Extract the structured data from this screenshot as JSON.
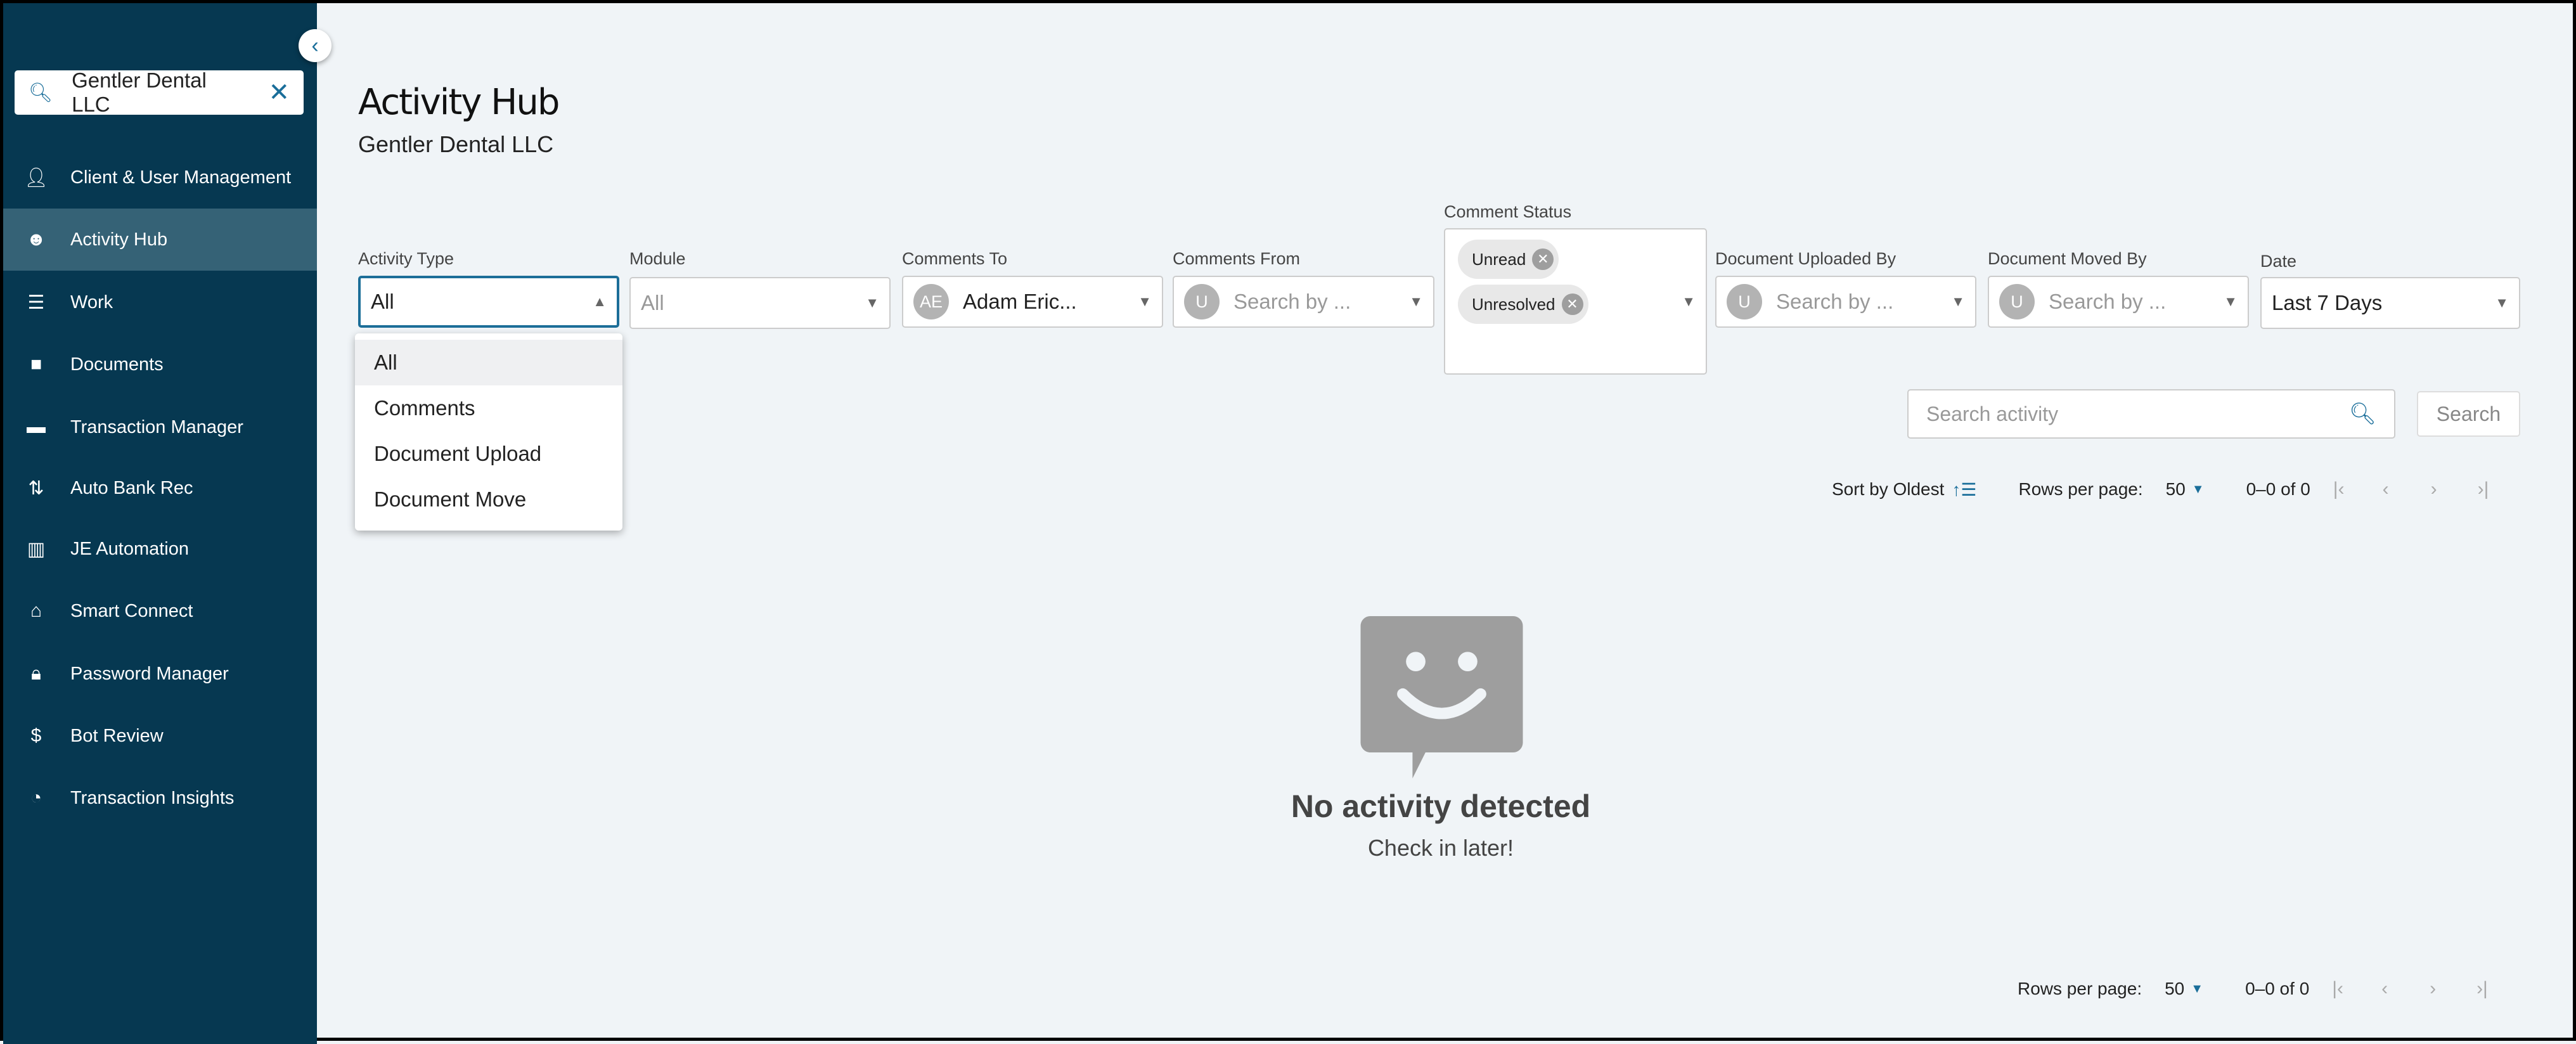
{
  "sidebar": {
    "company_search": "Gentler Dental LLC",
    "items": [
      {
        "label": "Client & User Management",
        "icon": "user-gear-icon"
      },
      {
        "label": "Activity Hub",
        "icon": "chat-smile-icon",
        "active": true
      },
      {
        "label": "Work",
        "icon": "checklist-icon"
      },
      {
        "label": "Documents",
        "icon": "folder-icon"
      },
      {
        "label": "Transaction Manager",
        "icon": "card-icon"
      },
      {
        "label": "Auto Bank Rec",
        "icon": "sync-icon"
      },
      {
        "label": "JE Automation",
        "icon": "book-icon"
      },
      {
        "label": "Smart Connect",
        "icon": "bank-icon"
      },
      {
        "label": "Password Manager",
        "icon": "lock-icon"
      },
      {
        "label": "Bot Review",
        "icon": "dollar-search-icon"
      },
      {
        "label": "Transaction Insights",
        "icon": "insights-icon"
      }
    ]
  },
  "header": {
    "title": "Activity Hub",
    "subtitle": "Gentler Dental LLC"
  },
  "filters": {
    "activity_type": {
      "label": "Activity Type",
      "value": "All",
      "options": [
        "All",
        "Comments",
        "Document Upload",
        "Document Move"
      ]
    },
    "module": {
      "label": "Module",
      "value": "All"
    },
    "comments_to": {
      "label": "Comments To",
      "avatar": "AE",
      "value": "Adam Eric..."
    },
    "comments_from": {
      "label": "Comments From",
      "avatar": "U",
      "placeholder": "Search by ..."
    },
    "comment_status": {
      "label": "Comment Status",
      "chips": [
        "Unread",
        "Unresolved"
      ]
    },
    "document_uploaded_by": {
      "label": "Document Uploaded By",
      "avatar": "U",
      "placeholder": "Search by ..."
    },
    "document_moved_by": {
      "label": "Document Moved By",
      "avatar": "U",
      "placeholder": "Search by ..."
    },
    "date": {
      "label": "Date",
      "value": "Last 7 Days"
    }
  },
  "search": {
    "placeholder": "Search activity",
    "button": "Search"
  },
  "pagination": {
    "sort_label": "Sort by Oldest",
    "rows_label": "Rows per page:",
    "rows_value": "50",
    "range": "0–0 of 0"
  },
  "empty": {
    "title": "No activity detected",
    "subtitle": "Check in later!"
  },
  "colors": {
    "sidebar": "#063851",
    "active": "#356276",
    "accent": "#1a6e9a",
    "background": "#f0f4f7"
  }
}
